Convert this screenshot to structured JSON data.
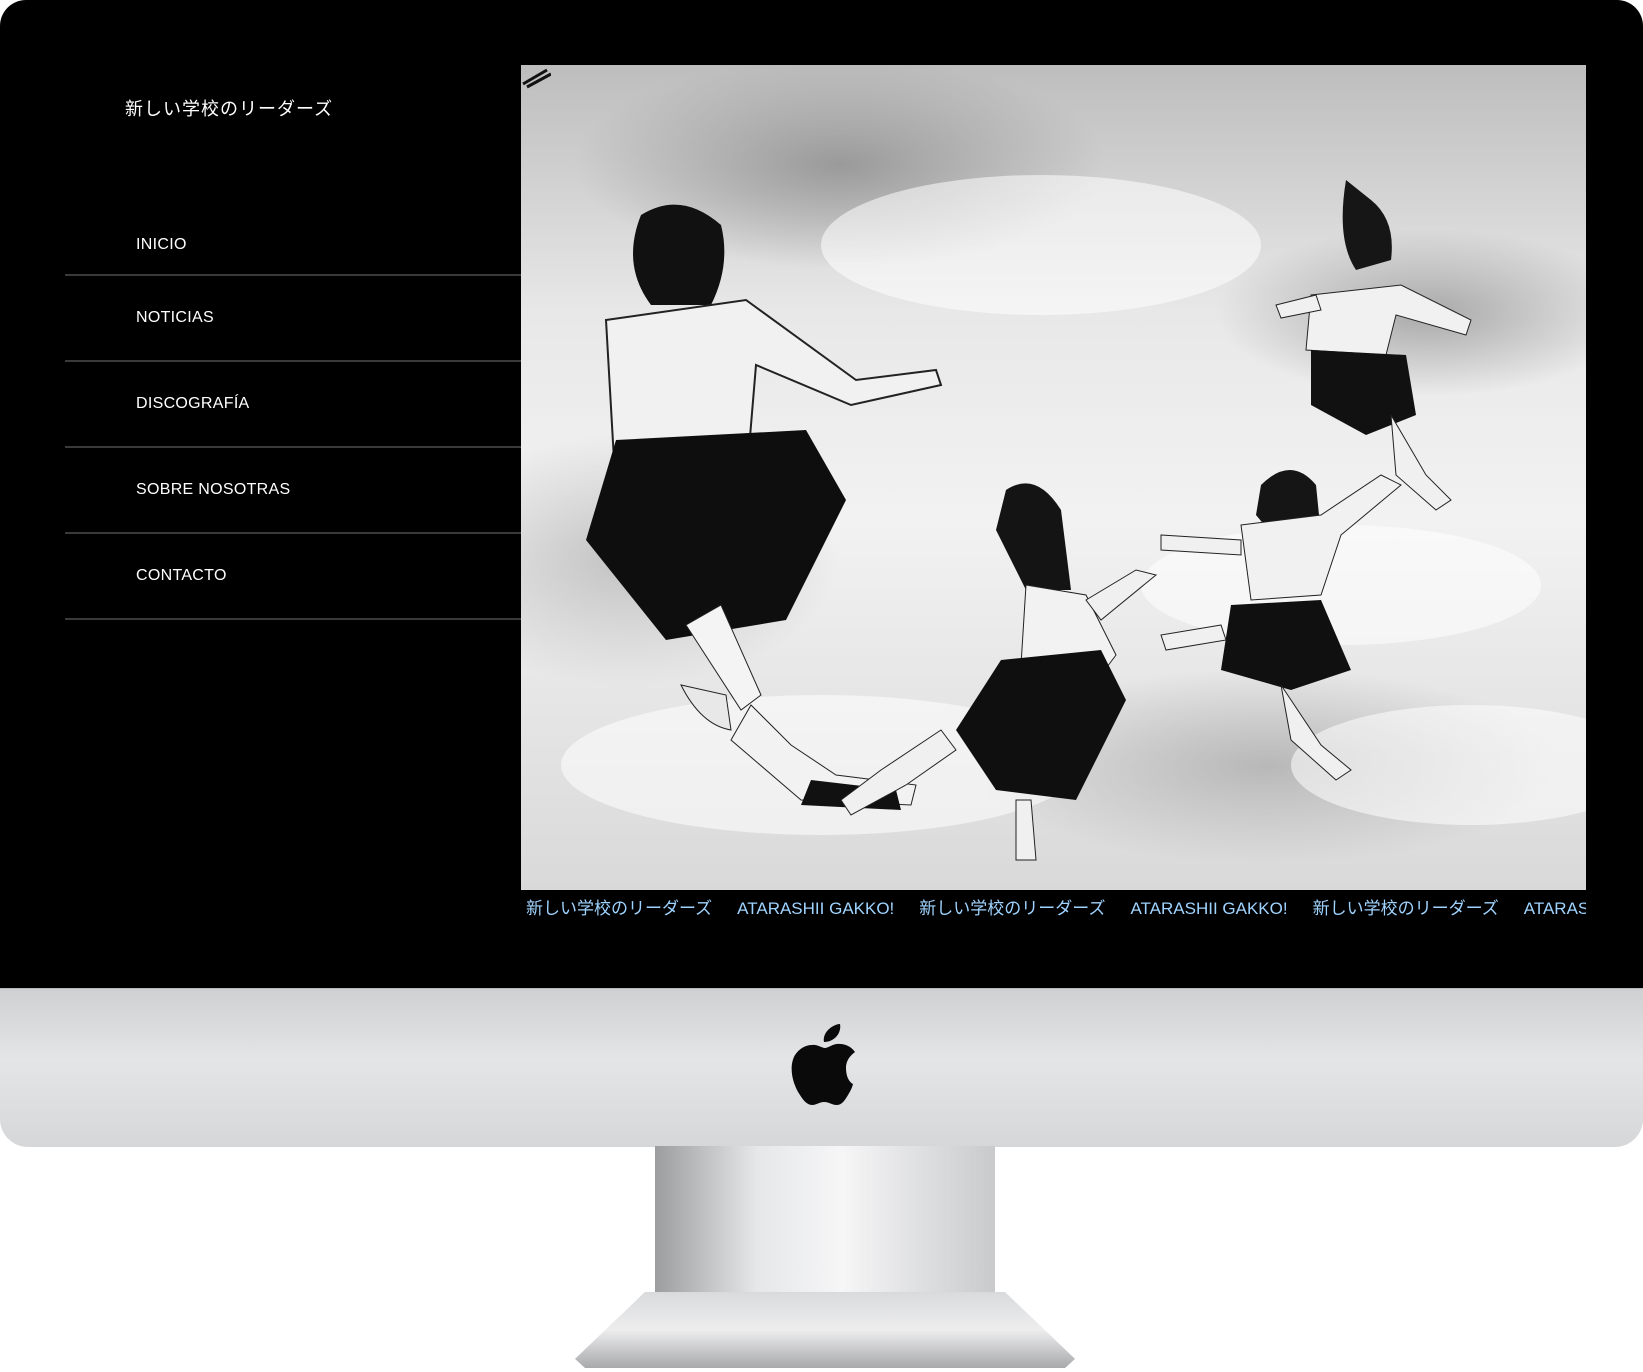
{
  "site": {
    "brand": "新しい学校のリーダーズ"
  },
  "nav": {
    "items": [
      {
        "label": "INICIO"
      },
      {
        "label": "NOTICIAS"
      },
      {
        "label": "DISCOGRAFÍA"
      },
      {
        "label": "SOBRE NOSOTRAS"
      },
      {
        "label": "CONTACTO"
      }
    ]
  },
  "hero": {
    "menu_icon": "hamburger-icon"
  },
  "ticker": {
    "items": [
      "新しい学校のリーダーズ",
      "ATARASHII GAKKO!",
      "新しい学校のリーダーズ",
      "ATARASHII GAKKO!",
      "新しい学校のリーダーズ",
      "ATARASH"
    ]
  },
  "colors": {
    "ticker_text": "#9fd3ff",
    "sidebar_bg": "#000000",
    "divider": "#3a3a3a"
  }
}
